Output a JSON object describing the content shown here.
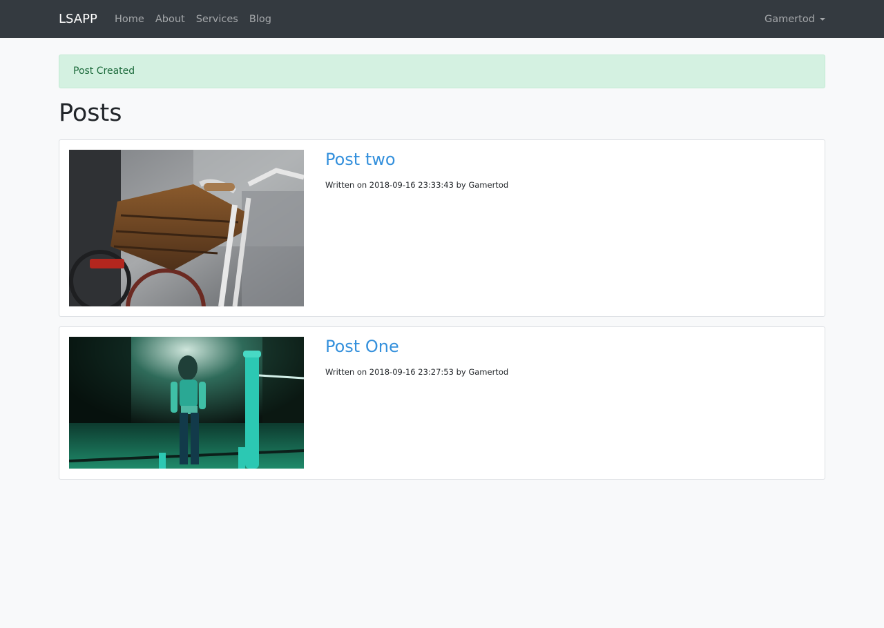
{
  "navbar": {
    "brand": "LSAPP",
    "links": [
      "Home",
      "About",
      "Services",
      "Blog"
    ],
    "user": "Gamertod"
  },
  "alert": {
    "message": "Post Created"
  },
  "page": {
    "title": "Posts"
  },
  "posts": [
    {
      "title": "Post two",
      "meta": "Written on 2018-09-16 23:33:43 by Gamertod"
    },
    {
      "title": "Post One",
      "meta": "Written on 2018-09-16 23:27:53 by Gamertod"
    }
  ],
  "colors": {
    "navbar_bg": "#343a40",
    "link": "#3490dc",
    "alert_bg": "#d4f1e1",
    "alert_text": "#1d6b3c",
    "page_bg": "#f8f9fa"
  }
}
